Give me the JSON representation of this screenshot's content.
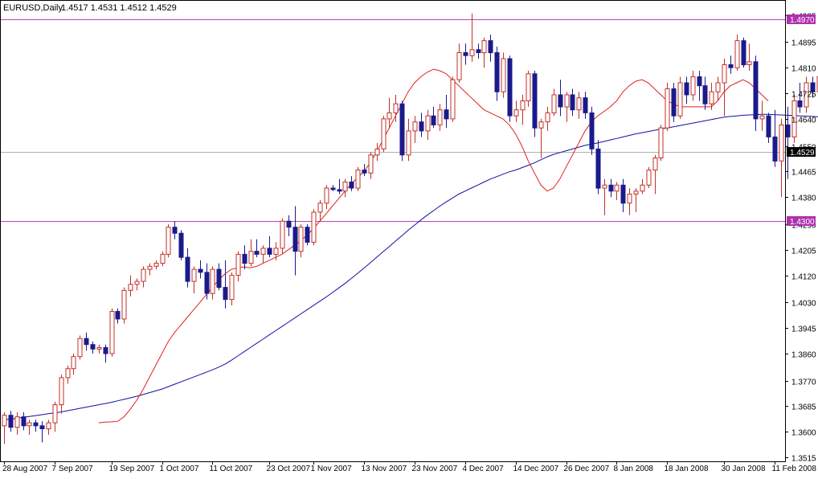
{
  "header": {
    "symbol": "EURUSD,Daily",
    "ohlc": "1.4517 1.4531 1.4512 1.4529"
  },
  "colors": {
    "bull": "#c0302a",
    "bear": "#1a1a8c",
    "ma_fast": "#e02020",
    "ma_slow": "#1010a0",
    "level_line": "#c040c0",
    "level_label_bg": "#b030b0",
    "current_line": "#b0b0b0",
    "axis": "#000000"
  },
  "chart_data": {
    "type": "candlestick",
    "symbol": "EURUSD",
    "timeframe": "Daily",
    "ylim": [
      1.351,
      1.4995
    ],
    "y_ticks": [
      "1.4985",
      "1.4895",
      "1.4810",
      "1.4725",
      "1.4640",
      "1.4550",
      "1.4465",
      "1.4380",
      "1.4290",
      "1.4205",
      "1.4120",
      "1.4030",
      "1.3945",
      "1.3860",
      "1.3770",
      "1.3685",
      "1.3600",
      "1.3515"
    ],
    "x_ticks": [
      {
        "label": "28 Aug 2007",
        "bar": 0
      },
      {
        "label": "7 Sep 2007",
        "bar": 8
      },
      {
        "label": "19 Sep 2007",
        "bar": 17
      },
      {
        "label": "1 Oct 2007",
        "bar": 25
      },
      {
        "label": "11 Oct 2007",
        "bar": 33
      },
      {
        "label": "23 Oct 2007",
        "bar": 42
      },
      {
        "label": "1 Nov 2007",
        "bar": 49
      },
      {
        "label": "13 Nov 2007",
        "bar": 57
      },
      {
        "label": "23 Nov 2007",
        "bar": 65
      },
      {
        "label": "4 Dec 2007",
        "bar": 73
      },
      {
        "label": "14 Dec 2007",
        "bar": 81
      },
      {
        "label": "26 Dec 2007",
        "bar": 89
      },
      {
        "label": "8 Jan 2008",
        "bar": 97
      },
      {
        "label": "18 Jan 2008",
        "bar": 105
      },
      {
        "label": "30 Jan 2008",
        "bar": 114
      },
      {
        "label": "11 Feb 2008",
        "bar": 122
      }
    ],
    "levels": [
      {
        "value": 1.497,
        "label": "1.4970"
      },
      {
        "value": 1.43,
        "label": "1.4300"
      }
    ],
    "current_price": {
      "value": 1.4529,
      "label": "1.4529"
    },
    "candles": [
      [
        1.362,
        1.3665,
        1.356,
        1.3655
      ],
      [
        1.3655,
        1.367,
        1.36,
        1.3615
      ],
      [
        1.3615,
        1.3665,
        1.359,
        1.365
      ],
      [
        1.365,
        1.3665,
        1.3605,
        1.362
      ],
      [
        1.362,
        1.364,
        1.359,
        1.363
      ],
      [
        1.363,
        1.364,
        1.36,
        1.362
      ],
      [
        1.362,
        1.3635,
        1.3565,
        1.361
      ],
      [
        1.361,
        1.364,
        1.359,
        1.363
      ],
      [
        1.363,
        1.37,
        1.36,
        1.369
      ],
      [
        1.369,
        1.379,
        1.366,
        1.378
      ],
      [
        1.378,
        1.382,
        1.376,
        1.381
      ],
      [
        1.381,
        1.386,
        1.379,
        1.385
      ],
      [
        1.385,
        1.392,
        1.384,
        1.391
      ],
      [
        1.391,
        1.393,
        1.387,
        1.389
      ],
      [
        1.389,
        1.39,
        1.386,
        1.3875
      ],
      [
        1.3875,
        1.389,
        1.386,
        1.388
      ],
      [
        1.388,
        1.389,
        1.383,
        1.386
      ],
      [
        1.386,
        1.401,
        1.385,
        1.4
      ],
      [
        1.4,
        1.401,
        1.396,
        1.3975
      ],
      [
        1.3975,
        1.408,
        1.396,
        1.407
      ],
      [
        1.407,
        1.412,
        1.405,
        1.409
      ],
      [
        1.409,
        1.411,
        1.407,
        1.41
      ],
      [
        1.41,
        1.415,
        1.408,
        1.414
      ],
      [
        1.414,
        1.416,
        1.412,
        1.415
      ],
      [
        1.415,
        1.417,
        1.414,
        1.416
      ],
      [
        1.416,
        1.42,
        1.415,
        1.419
      ],
      [
        1.419,
        1.429,
        1.418,
        1.428
      ],
      [
        1.428,
        1.43,
        1.424,
        1.426
      ],
      [
        1.426,
        1.427,
        1.417,
        1.418
      ],
      [
        1.418,
        1.421,
        1.408,
        1.41
      ],
      [
        1.41,
        1.415,
        1.406,
        1.414
      ],
      [
        1.414,
        1.417,
        1.411,
        1.413
      ],
      [
        1.413,
        1.416,
        1.404,
        1.406
      ],
      [
        1.406,
        1.415,
        1.404,
        1.414
      ],
      [
        1.414,
        1.416,
        1.407,
        1.408
      ],
      [
        1.408,
        1.417,
        1.401,
        1.404
      ],
      [
        1.404,
        1.413,
        1.402,
        1.412
      ],
      [
        1.412,
        1.42,
        1.41,
        1.419
      ],
      [
        1.419,
        1.422,
        1.414,
        1.416
      ],
      [
        1.416,
        1.424,
        1.415,
        1.42
      ],
      [
        1.42,
        1.424,
        1.418,
        1.419
      ],
      [
        1.419,
        1.422,
        1.416,
        1.421
      ],
      [
        1.421,
        1.425,
        1.418,
        1.419
      ],
      [
        1.419,
        1.423,
        1.417,
        1.421
      ],
      [
        1.421,
        1.431,
        1.419,
        1.43
      ],
      [
        1.43,
        1.432,
        1.425,
        1.428
      ],
      [
        1.428,
        1.435,
        1.412,
        1.42
      ],
      [
        1.42,
        1.429,
        1.418,
        1.428
      ],
      [
        1.428,
        1.429,
        1.422,
        1.423
      ],
      [
        1.423,
        1.434,
        1.422,
        1.433
      ],
      [
        1.433,
        1.437,
        1.43,
        1.436
      ],
      [
        1.436,
        1.442,
        1.434,
        1.441
      ],
      [
        1.441,
        1.442,
        1.44,
        1.4405
      ],
      [
        1.4405,
        1.444,
        1.439,
        1.44
      ],
      [
        1.44,
        1.444,
        1.438,
        1.443
      ],
      [
        1.443,
        1.445,
        1.44,
        1.441
      ],
      [
        1.441,
        1.448,
        1.44,
        1.447
      ],
      [
        1.447,
        1.449,
        1.445,
        1.446
      ],
      [
        1.446,
        1.453,
        1.444,
        1.452
      ],
      [
        1.452,
        1.456,
        1.45,
        1.454
      ],
      [
        1.454,
        1.465,
        1.453,
        1.464
      ],
      [
        1.464,
        1.471,
        1.461,
        1.466
      ],
      [
        1.466,
        1.472,
        1.463,
        1.469
      ],
      [
        1.469,
        1.47,
        1.45,
        1.452
      ],
      [
        1.452,
        1.464,
        1.45,
        1.46
      ],
      [
        1.46,
        1.465,
        1.456,
        1.463
      ],
      [
        1.463,
        1.466,
        1.458,
        1.46
      ],
      [
        1.46,
        1.467,
        1.457,
        1.465
      ],
      [
        1.465,
        1.468,
        1.461,
        1.462
      ],
      [
        1.462,
        1.469,
        1.46,
        1.467
      ],
      [
        1.467,
        1.472,
        1.461,
        1.464
      ],
      [
        1.464,
        1.478,
        1.463,
        1.477
      ],
      [
        1.477,
        1.489,
        1.476,
        1.486
      ],
      [
        1.486,
        1.489,
        1.482,
        1.485
      ],
      [
        1.485,
        1.499,
        1.483,
        1.487
      ],
      [
        1.487,
        1.489,
        1.484,
        1.486
      ],
      [
        1.486,
        1.491,
        1.481,
        1.49
      ],
      [
        1.49,
        1.492,
        1.483,
        1.486
      ],
      [
        1.486,
        1.488,
        1.47,
        1.473
      ],
      [
        1.473,
        1.486,
        1.471,
        1.484
      ],
      [
        1.484,
        1.485,
        1.463,
        1.465
      ],
      [
        1.465,
        1.47,
        1.463,
        1.467
      ],
      [
        1.467,
        1.472,
        1.462,
        1.47
      ],
      [
        1.47,
        1.48,
        1.468,
        1.479
      ],
      [
        1.479,
        1.48,
        1.458,
        1.461
      ],
      [
        1.461,
        1.464,
        1.451,
        1.463
      ],
      [
        1.463,
        1.468,
        1.46,
        1.466
      ],
      [
        1.466,
        1.474,
        1.465,
        1.472
      ],
      [
        1.472,
        1.477,
        1.465,
        1.468
      ],
      [
        1.468,
        1.473,
        1.463,
        1.472
      ],
      [
        1.472,
        1.474,
        1.465,
        1.467
      ],
      [
        1.467,
        1.473,
        1.464,
        1.471
      ],
      [
        1.471,
        1.473,
        1.464,
        1.466
      ],
      [
        1.466,
        1.468,
        1.452,
        1.454
      ],
      [
        1.454,
        1.457,
        1.439,
        1.441
      ],
      [
        1.441,
        1.444,
        1.432,
        1.442
      ],
      [
        1.442,
        1.444,
        1.438,
        1.44
      ],
      [
        1.44,
        1.443,
        1.437,
        1.442
      ],
      [
        1.442,
        1.444,
        1.433,
        1.436
      ],
      [
        1.436,
        1.441,
        1.432,
        1.439
      ],
      [
        1.439,
        1.441,
        1.433,
        1.44
      ],
      [
        1.44,
        1.444,
        1.439,
        1.442
      ],
      [
        1.442,
        1.448,
        1.441,
        1.447
      ],
      [
        1.447,
        1.452,
        1.439,
        1.451
      ],
      [
        1.451,
        1.462,
        1.45,
        1.461
      ],
      [
        1.461,
        1.476,
        1.46,
        1.474
      ],
      [
        1.474,
        1.476,
        1.463,
        1.465
      ],
      [
        1.465,
        1.478,
        1.464,
        1.476
      ],
      [
        1.476,
        1.478,
        1.469,
        1.472
      ],
      [
        1.472,
        1.48,
        1.47,
        1.478
      ],
      [
        1.478,
        1.48,
        1.47,
        1.475
      ],
      [
        1.475,
        1.478,
        1.467,
        1.469
      ],
      [
        1.469,
        1.476,
        1.467,
        1.473
      ],
      [
        1.473,
        1.478,
        1.47,
        1.476
      ],
      [
        1.476,
        1.484,
        1.465,
        1.482
      ],
      [
        1.482,
        1.485,
        1.479,
        1.481
      ],
      [
        1.481,
        1.492,
        1.48,
        1.49
      ],
      [
        1.49,
        1.491,
        1.481,
        1.482
      ],
      [
        1.482,
        1.489,
        1.48,
        1.483
      ],
      [
        1.483,
        1.485,
        1.46,
        1.464
      ],
      [
        1.464,
        1.47,
        1.46,
        1.465
      ],
      [
        1.465,
        1.466,
        1.456,
        1.458
      ],
      [
        1.458,
        1.467,
        1.448,
        1.45
      ],
      [
        1.45,
        1.464,
        1.438,
        1.462
      ],
      [
        1.462,
        1.468,
        1.444,
        1.458
      ],
      [
        1.458,
        1.472,
        1.456,
        1.47
      ],
      [
        1.47,
        1.476,
        1.466,
        1.468
      ],
      [
        1.468,
        1.478,
        1.466,
        1.476
      ],
      [
        1.476,
        1.478,
        1.471,
        1.473
      ],
      [
        1.473,
        1.48,
        1.471,
        1.478
      ],
      [
        1.478,
        1.488,
        1.476,
        1.487
      ],
      [
        1.487,
        1.488,
        1.479,
        1.481
      ],
      [
        1.481,
        1.488,
        1.479,
        1.486
      ],
      [
        1.486,
        1.495,
        1.482,
        1.485
      ],
      [
        1.485,
        1.487,
        1.478,
        1.48
      ],
      [
        1.48,
        1.483,
        1.479,
        1.482
      ],
      [
        1.482,
        1.484,
        1.462,
        1.465
      ],
      [
        1.465,
        1.466,
        1.462,
        1.463
      ],
      [
        1.463,
        1.465,
        1.456,
        1.464
      ],
      [
        1.464,
        1.466,
        1.444,
        1.448
      ],
      [
        1.448,
        1.452,
        1.446,
        1.451
      ],
      [
        1.4517,
        1.4531,
        1.4512,
        1.4529
      ]
    ],
    "ma_fast": [
      1.363,
      1.3632,
      1.3633,
      1.3635,
      1.365,
      1.3675,
      1.3705,
      1.374,
      1.378,
      1.382,
      1.386,
      1.39,
      1.393,
      1.3955,
      1.398,
      1.4005,
      1.403,
      1.4055,
      1.408,
      1.4105,
      1.4125,
      1.414,
      1.4145,
      1.4148,
      1.4145,
      1.415,
      1.416,
      1.417,
      1.418,
      1.419,
      1.4205,
      1.422,
      1.4235,
      1.4255,
      1.4275,
      1.43,
      1.4325,
      1.435,
      1.4375,
      1.44,
      1.4425,
      1.4445,
      1.4465,
      1.4495,
      1.453,
      1.457,
      1.461,
      1.465,
      1.469,
      1.473,
      1.476,
      1.478,
      1.4795,
      1.4805,
      1.48,
      1.479,
      1.477,
      1.475,
      1.473,
      1.471,
      1.469,
      1.467,
      1.466,
      1.465,
      1.464,
      1.462,
      1.459,
      1.455,
      1.45,
      1.446,
      1.442,
      1.44,
      1.441,
      1.444,
      1.448,
      1.452,
      1.456,
      1.46,
      1.463,
      1.465,
      1.4665,
      1.468,
      1.47,
      1.473,
      1.475,
      1.4765,
      1.477,
      1.476,
      1.474,
      1.472,
      1.47,
      1.469,
      1.468,
      1.468,
      1.468,
      1.468,
      1.468,
      1.468,
      1.47,
      1.473,
      1.475,
      1.476,
      1.477,
      1.476,
      1.474,
      1.472,
      1.47
    ],
    "ma_fast_start": 15,
    "ma_slow": [
      1.364,
      1.3642,
      1.3645,
      1.3648,
      1.3651,
      1.3654,
      1.3657,
      1.366,
      1.3663,
      1.3666,
      1.367,
      1.3674,
      1.3678,
      1.3682,
      1.3686,
      1.369,
      1.3694,
      1.3698,
      1.3703,
      1.3708,
      1.3713,
      1.3718,
      1.3724,
      1.373,
      1.3736,
      1.3742,
      1.375,
      1.3758,
      1.3766,
      1.3774,
      1.3782,
      1.379,
      1.3798,
      1.3806,
      1.3815,
      1.3825,
      1.3838,
      1.3852,
      1.3866,
      1.388,
      1.3894,
      1.3908,
      1.3922,
      1.3936,
      1.395,
      1.3964,
      1.3978,
      1.3992,
      1.4006,
      1.402,
      1.4034,
      1.4048,
      1.4063,
      1.4078,
      1.4093,
      1.411,
      1.4127,
      1.4144,
      1.4162,
      1.418,
      1.4198,
      1.4216,
      1.4234,
      1.4252,
      1.427,
      1.4287,
      1.4304,
      1.432,
      1.4335,
      1.435,
      1.4364,
      1.4377,
      1.439,
      1.44,
      1.441,
      1.442,
      1.443,
      1.444,
      1.4448,
      1.4456,
      1.4464,
      1.447,
      1.4478,
      1.4486,
      1.4494,
      1.4504,
      1.4514,
      1.4522,
      1.4528,
      1.4534,
      1.454,
      1.4546,
      1.4552,
      1.4556,
      1.456,
      1.4565,
      1.457,
      1.4575,
      1.458,
      1.4585,
      1.459,
      1.4594,
      1.4598,
      1.4602,
      1.4606,
      1.461,
      1.4614,
      1.4618,
      1.4622,
      1.4626,
      1.463,
      1.4634,
      1.4638,
      1.4642,
      1.4646,
      1.4648,
      1.465,
      1.4652,
      1.4653,
      1.4654,
      1.4655,
      1.4655,
      1.4654,
      1.4653,
      1.4652,
      1.4651,
      1.465,
      1.4649,
      1.4648,
      1.4647
    ]
  }
}
